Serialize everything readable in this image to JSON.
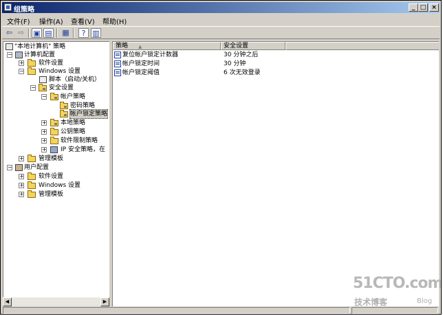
{
  "window": {
    "title": "组策略"
  },
  "menu": [
    {
      "label": "文件(F)"
    },
    {
      "label": "操作(A)"
    },
    {
      "label": "查看(V)"
    },
    {
      "label": "帮助(H)"
    }
  ],
  "toolbar": {
    "buttons": [
      "back-arrow-icon",
      "forward-arrow-icon",
      "up-folder-icon",
      "show-hide-tree-icon",
      "export-list-icon",
      "help-icon",
      "properties-icon"
    ]
  },
  "tree": {
    "root": "\"本地计算机\" 策略",
    "computer_config": "计算机配置",
    "software_settings": "软件设置",
    "windows_settings": "Windows 设置",
    "scripts": "脚本（启动/关机）",
    "security_settings": "安全设置",
    "account_policy": "帐户策略",
    "password_policy": "密码策略",
    "lockout_policy": "帐户锁定策略",
    "local_policy": "本地策略",
    "public_key_policy": "公钥策略",
    "software_restriction": "软件限制策略",
    "ip_security": "IP 安全策略，在",
    "admin_templates": "管理模板",
    "user_config": "用户配置",
    "user_software_settings": "软件设置",
    "user_windows_settings": "Windows 设置",
    "user_admin_templates": "管理模板"
  },
  "list": {
    "columns": [
      "策略",
      "安全设置"
    ],
    "rows": [
      {
        "policy": "复位帐户锁定计数器",
        "setting": "30 分钟之后"
      },
      {
        "policy": "帐户锁定时间",
        "setting": "30 分钟"
      },
      {
        "policy": "帐户锁定阈值",
        "setting": "6 次无效登录"
      }
    ]
  },
  "watermark": {
    "main": "51CTO.com",
    "sub": "技术博客",
    "blog": "Blog"
  }
}
